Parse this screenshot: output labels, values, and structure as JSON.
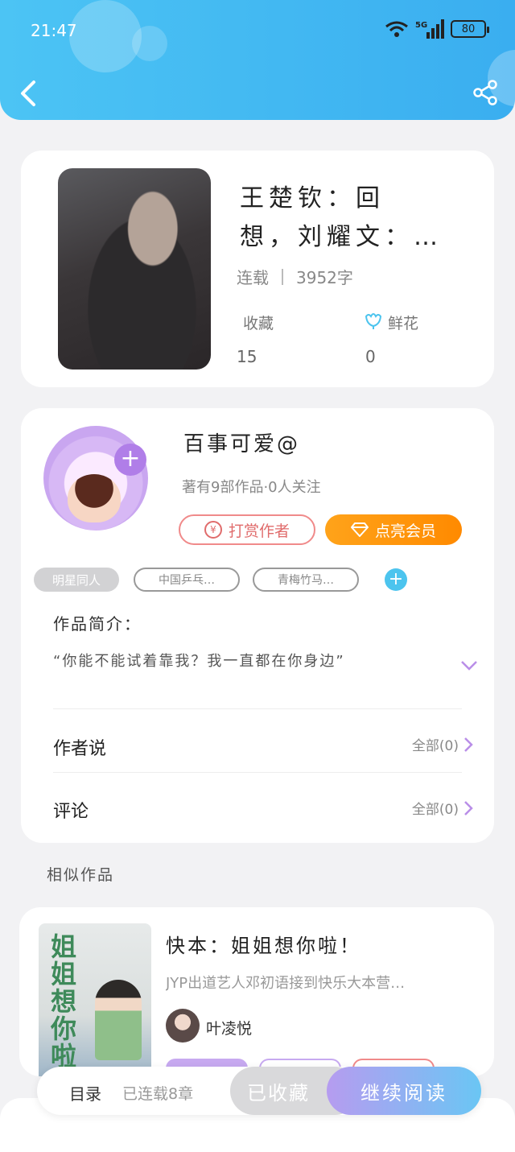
{
  "status_bar": {
    "time": "21:47",
    "network": "5G",
    "battery": "80"
  },
  "book": {
    "title": "王楚钦：回想，刘耀文：有姐…",
    "status": "连载",
    "word_count": "3952字",
    "favorites_label": "收藏",
    "favorites_value": "15",
    "flowers_label": "鲜花",
    "flowers_value": "0"
  },
  "author": {
    "name": "百事可爱@",
    "info": "著有9部作品·0人关注",
    "reward_label": "打赏作者",
    "yen_symbol": "¥",
    "vip_label": "点亮会员"
  },
  "tags": [
    "明星同人",
    "中国乒乓…",
    "青梅竹马…"
  ],
  "tag_add": "+",
  "intro": {
    "title": "作品简介：",
    "text": "“你能不能试着靠我？我一直都在你身边”"
  },
  "author_says": {
    "label": "作者说",
    "value": "全部(0)"
  },
  "comments": {
    "label": "评论",
    "value": "全部(0)"
  },
  "similar": {
    "heading": "相似作品",
    "title": "快本：姐姐想你啦！",
    "desc": "JYP出道艺人邓初语接到快乐大本营…",
    "author": "叶凌悦",
    "cover_text": "姐姐想你啦",
    "tag_colors": [
      "#c7a9f0",
      "#c7a9f0",
      "#f08a8a"
    ]
  },
  "bottom_bar": {
    "toc": "目录",
    "chapters": "已连载8章",
    "favorited": "已收藏",
    "continue": "继续阅读"
  },
  "colors": {
    "header": "#3aaef0",
    "accent_purple": "#b07ee8",
    "vip_orange": "#ff8a00",
    "reward_red": "#e06c6c"
  }
}
